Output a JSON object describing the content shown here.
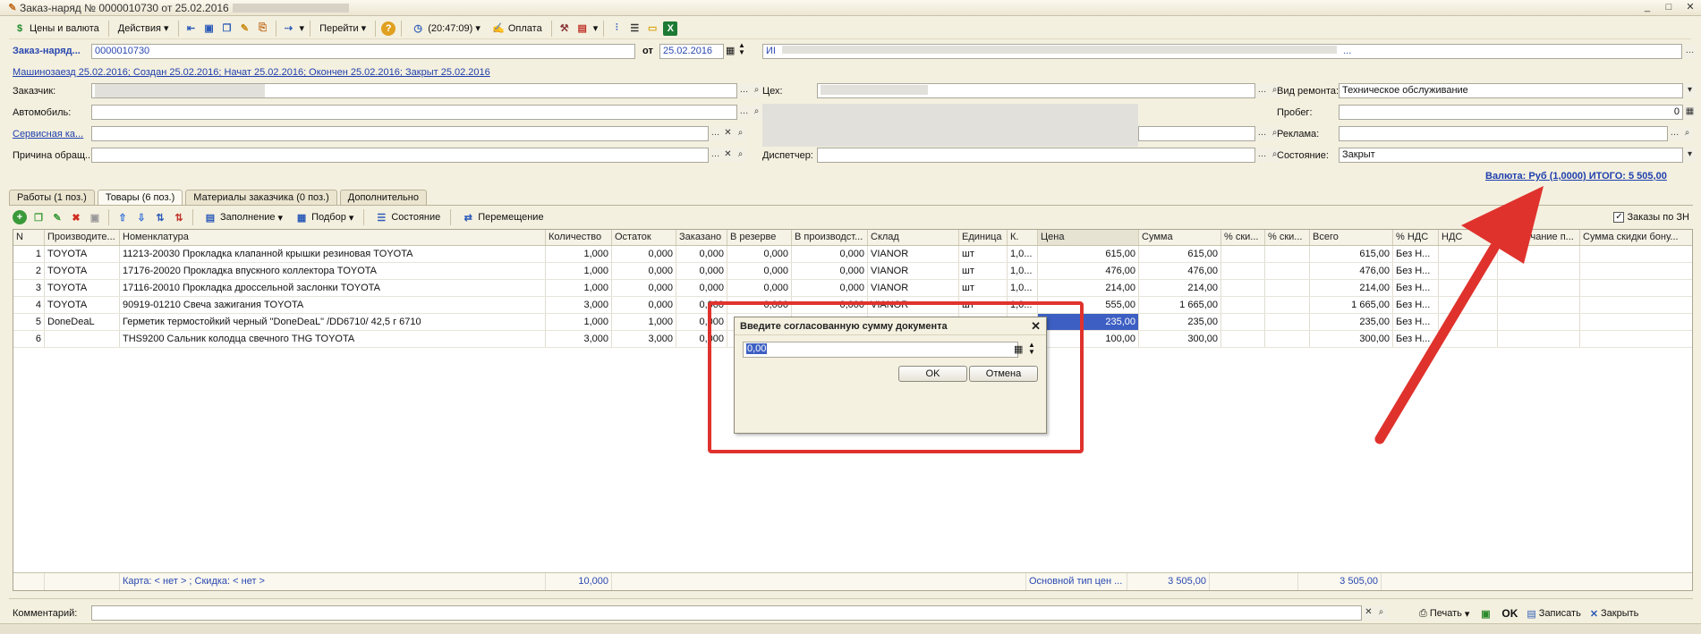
{
  "window": {
    "title": "Заказ-наряд № 0000010730 от 25.02.2016",
    "minimize": "_",
    "restore": "□",
    "close": "✕"
  },
  "toolbar": {
    "prices_currency": "Цены и валюта",
    "actions": "Действия",
    "goto": "Перейти",
    "time": "(20:47:09)",
    "payment": "Оплата"
  },
  "header": {
    "order_label": "Заказ-наряд...",
    "order_number": "0000010730",
    "from_label": "от",
    "date": "25.02.2016",
    "org_prefix": "ИI",
    "org_suffix": "...",
    "history_link": "Машинозаезд 25.02.2016; Создан 25.02.2016; Начат 25.02.2016; Окончен 25.02.2016; Закрыт 25.02.2016"
  },
  "fields": {
    "customer_label": "Заказчик:",
    "car_label": "Автомобиль:",
    "service_card_label": "Сервисная ка...",
    "reason_label": "Причина обращ...",
    "shop_label": "Цех:",
    "dispatcher_label": "Диспетчер:",
    "repair_type_label": "Вид ремонта:",
    "repair_type_value": "Техническое обслуживание",
    "mileage_label": "Пробег:",
    "mileage_value": "0",
    "ad_label": "Реклама:",
    "state_label": "Состояние:",
    "state_value": "Закрыт"
  },
  "total_link": "Валюта: Руб (1,0000) ИТОГО: 5 505,00",
  "tabs": [
    {
      "label": "Работы (1 поз.)"
    },
    {
      "label": "Товары (6 поз.)"
    },
    {
      "label": "Материалы заказчика (0 поз.)"
    },
    {
      "label": "Дополнительно"
    }
  ],
  "grid_toolbar": {
    "fill": "Заполнение",
    "select": "Подбор",
    "state": "Состояние",
    "move": "Перемещение",
    "orders_checkbox": "Заказы по ЗН"
  },
  "table": {
    "columns": [
      "N",
      "Производите...",
      "Номенклатура",
      "Количество",
      "Остаток",
      "Заказано",
      "В резерве",
      "В производст...",
      "Склад",
      "Единица",
      "К.",
      "Цена",
      "Сумма",
      "% ски...",
      "% ски...",
      "Всего",
      "% НДС",
      "НДС",
      "Примечание п...",
      "Сумма скидки бону..."
    ],
    "rows": [
      [
        "1",
        "TOYOTA",
        "11213-20030  Прокладка клапанной крышки резиновая TOYOTA",
        "1,000",
        "0,000",
        "0,000",
        "0,000",
        "0,000",
        "VIANOR",
        "шт",
        "1,0...",
        "615,00",
        "615,00",
        "",
        "",
        "615,00",
        "Без Н...",
        "",
        "",
        ""
      ],
      [
        "2",
        "TOYOTA",
        "17176-20020 Прокладка впускного коллектора TOYOTA",
        "1,000",
        "0,000",
        "0,000",
        "0,000",
        "0,000",
        "VIANOR",
        "шт",
        "1,0...",
        "476,00",
        "476,00",
        "",
        "",
        "476,00",
        "Без Н...",
        "",
        "",
        ""
      ],
      [
        "3",
        "TOYOTA",
        "17116-20010 Прокладка дроссельной заслонки TOYOTA",
        "1,000",
        "0,000",
        "0,000",
        "0,000",
        "0,000",
        "VIANOR",
        "шт",
        "1,0...",
        "214,00",
        "214,00",
        "",
        "",
        "214,00",
        "Без Н...",
        "",
        "",
        ""
      ],
      [
        "4",
        "TOYOTA",
        "90919-01210      Свеча зажигания TOYOTA",
        "3,000",
        "0,000",
        "0,000",
        "0,000",
        "0,000",
        "VIANOR",
        "шт",
        "1,0...",
        "555,00",
        "1 665,00",
        "",
        "",
        "1 665,00",
        "Без Н...",
        "",
        "",
        ""
      ],
      [
        "5",
        "DoneDeaL",
        "Герметик термостойкий черный  \"DoneDeaL\" /DD6710/ 42,5 г 6710",
        "1,000",
        "1,000",
        "0,000",
        "",
        "",
        "",
        "",
        "",
        "235,00",
        "235,00",
        "",
        "",
        "235,00",
        "Без Н...",
        "",
        "",
        ""
      ],
      [
        "6",
        "",
        "THS9200 Сальник колодца свечного  THG TOYOTA",
        "3,000",
        "3,000",
        "0,000",
        "",
        "",
        "",
        "",
        "",
        "100,00",
        "300,00",
        "",
        "",
        "300,00",
        "Без Н...",
        "",
        "",
        ""
      ]
    ],
    "footer": {
      "card": "Карта: < нет > ; Скидка: < нет >",
      "qty_total": "10,000",
      "price_type": "Основной тип цен ...",
      "sum_total": "3 505,00",
      "all_total": "3 505,00"
    }
  },
  "dialog": {
    "title": "Введите согласованную сумму документа",
    "value": "0,00",
    "ok": "OK",
    "cancel": "Отмена"
  },
  "bottom": {
    "comment_label": "Комментарий:",
    "print": "Печать",
    "ok": "OK",
    "save": "Записать",
    "close": "Закрыть"
  },
  "colors": {
    "annotation_red": "#e0322d",
    "link_blue": "#1f3fae",
    "selection": "#3d5fc3"
  }
}
